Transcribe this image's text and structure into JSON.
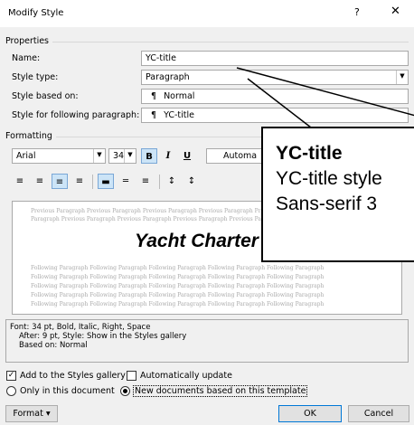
{
  "window": {
    "title": "Modify Style",
    "help": "?",
    "close": "✕"
  },
  "properties": {
    "heading": "Properties",
    "name_label": "Name:",
    "name_value": "YC-title",
    "type_label": "Style type:",
    "type_value": "Paragraph",
    "based_label": "Style based on:",
    "based_value": "Normal",
    "following_label": "Style for following paragraph:",
    "following_value": "YC-title",
    "para_mark": "¶"
  },
  "formatting": {
    "heading": "Formatting",
    "font": "Arial",
    "size": "34",
    "bold": "B",
    "italic": "I",
    "underline": "U",
    "color": "Automa",
    "align_right_selected": true
  },
  "preview": {
    "previous_line1": "Previous Paragraph Previous Paragraph Previous Paragraph Previous Paragraph Previous Paragraph Previous Parag",
    "previous_line2": "Paragraph Previous Paragraph Previous Paragraph Previous Paragraph Previous Paragraph Previous Paragraph",
    "sample": "Yacht Charter Guide",
    "following_line": "Following Paragraph Following Paragraph Following Paragraph Following Paragraph Following Paragraph"
  },
  "description": {
    "line1": "Font: 34 pt, Bold, Italic, Right, Space",
    "line2": "After:  9 pt, Style: Show in the Styles gallery",
    "line3": "Based on: Normal"
  },
  "options": {
    "add_gallery": "Add to the Styles gallery",
    "add_gallery_checked": "✓",
    "auto_update": "Automatically update",
    "only_doc": "Only in this document",
    "new_docs": "New documents based on this template"
  },
  "buttons": {
    "format": "Format ▾",
    "ok": "OK",
    "cancel": "Cancel"
  },
  "callout": {
    "line1": "YC-title",
    "line2": "YC-title style",
    "line3": "Sans-serif 3"
  }
}
